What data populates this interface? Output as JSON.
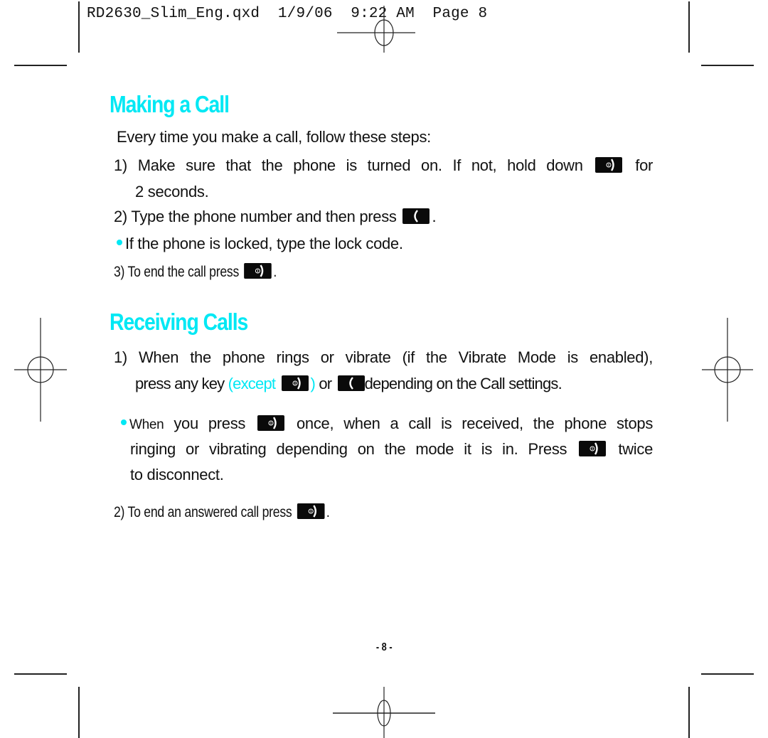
{
  "slug": {
    "filename": "RD2630_Slim_Eng.qxd",
    "date": "1/9/06",
    "time": "9:22 AM",
    "page_label": "Page 8"
  },
  "section_making": {
    "title": "Making a Call",
    "intro": "Every time you make a call, follow these steps:",
    "step1_num": "1)",
    "step1_text_a": "Make sure that the phone is turned on. If not, hold down",
    "step1_text_b": "for",
    "step1_text_c": "2 seconds.",
    "step2_num": "2)",
    "step2_text": "Type the phone number and then press",
    "step2_end": ".",
    "bullet_text": "If the phone is locked, type the lock code.",
    "step3_num": "3)",
    "step3_text": "To end the call press",
    "step3_end": "."
  },
  "section_receiving": {
    "title": "Receiving Calls",
    "step1_num": "1)",
    "step1_line1": "When the phone rings or vibrate (if the Vibrate Mode is enabled),",
    "step1_line2_a": "press any key",
    "step1_line2_except": "(except",
    "step1_line2_paren": ")",
    "step1_line2_or": "or",
    "step1_line2_b": "depending on the Call settings.",
    "bullet_a": "When",
    "bullet_b": "you press",
    "bullet_c": "once, when a call is received, the phone stops",
    "bullet_line2_a": "ringing or vibrating depending on the mode it is in. Press",
    "bullet_line2_b": "twice",
    "bullet_line3": "to disconnect.",
    "step2_num": "2)",
    "step2_text": "To end an answered call press",
    "step2_end": "."
  },
  "icons": {
    "end_key": "end-power-key-icon",
    "send_key": "send-talk-key-icon"
  },
  "colors": {
    "heading": "#00e8f4",
    "bullet": "#00e8f4",
    "text": "#111111",
    "key_bg": "#0a0a0a"
  },
  "footer": {
    "page_number": "- 8 -"
  }
}
